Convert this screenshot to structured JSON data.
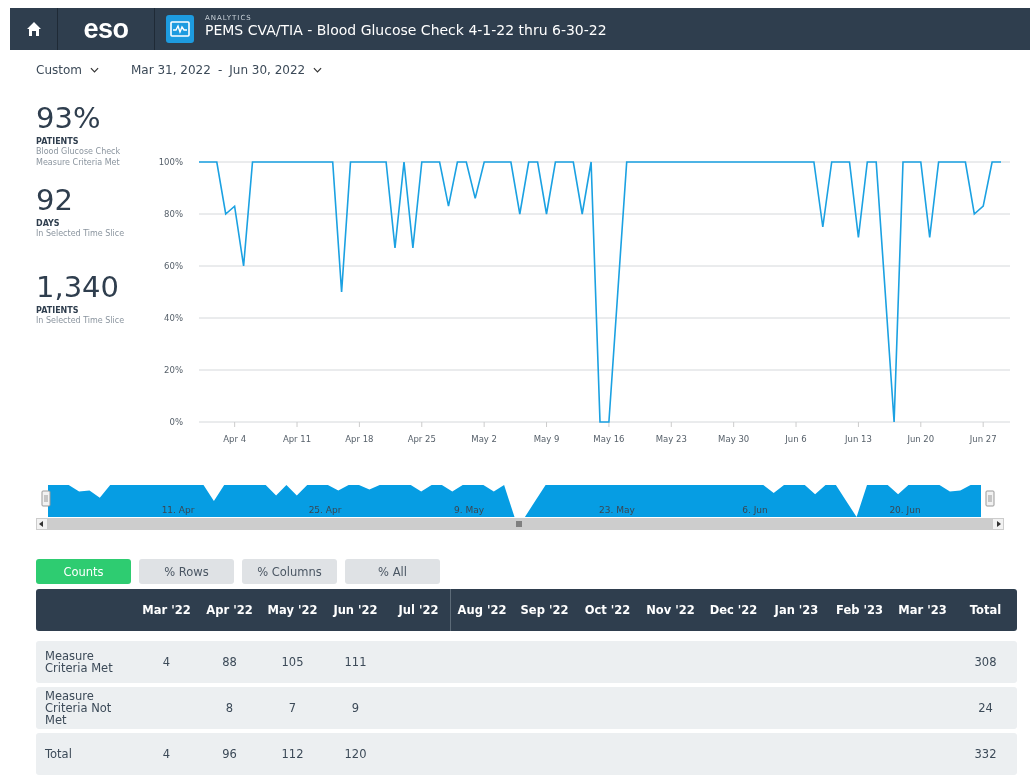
{
  "header": {
    "logo": "eso",
    "section": "ANALYTICS",
    "title": "PEMS CVA/TIA - Blood Glucose Check 4-1-22 thru 6-30-22"
  },
  "filters": {
    "period": "Custom",
    "date_from": "Mar 31, 2022",
    "separator": "-",
    "date_to": "Jun 30, 2022"
  },
  "stats": [
    {
      "value": "93%",
      "label": "PATIENTS",
      "caption": "Blood Glucose Check Measure Criteria Met"
    },
    {
      "value": "92",
      "label": "DAYS",
      "caption": "In Selected Time Slice"
    },
    {
      "value": "1,340",
      "label": "PATIENTS",
      "caption": "In Selected Time Slice"
    }
  ],
  "chart": {
    "chart_data": {
      "type": "line",
      "grid": true,
      "ylim": [
        0,
        100
      ],
      "categories": [
        null,
        null,
        null,
        null,
        "Apr 4",
        null,
        null,
        null,
        null,
        null,
        null,
        "Apr 11",
        null,
        null,
        null,
        null,
        null,
        null,
        "Apr 18",
        null,
        null,
        null,
        null,
        null,
        null,
        "Apr 25",
        null,
        null,
        null,
        null,
        null,
        null,
        "May 2",
        null,
        null,
        null,
        null,
        null,
        null,
        "May 9",
        null,
        null,
        null,
        null,
        null,
        null,
        "May 16",
        null,
        null,
        null,
        null,
        null,
        null,
        "May 23",
        null,
        null,
        null,
        null,
        null,
        null,
        "May 30",
        null,
        null,
        null,
        null,
        null,
        null,
        "Jun 6",
        null,
        null,
        null,
        null,
        null,
        null,
        "Jun 13",
        null,
        null,
        null,
        null,
        null,
        null,
        "Jun 20",
        null,
        null,
        null,
        null,
        null,
        null,
        "Jun 27",
        null,
        null
      ],
      "yticks": [
        {
          "value": 0,
          "label": "0%"
        },
        {
          "value": 20,
          "label": "20%"
        },
        {
          "value": 40,
          "label": "40%"
        },
        {
          "value": 60,
          "label": "60%"
        },
        {
          "value": 80,
          "label": "80%"
        },
        {
          "value": 100,
          "label": "100%"
        }
      ],
      "series": [
        {
          "color": "#1ba1e2",
          "values": [
            100,
            100,
            100,
            80,
            83,
            60,
            100,
            100,
            100,
            100,
            100,
            100,
            100,
            100,
            100,
            100,
            50,
            100,
            100,
            100,
            100,
            100,
            67,
            100,
            67,
            100,
            100,
            100,
            83,
            100,
            100,
            86,
            100,
            100,
            100,
            100,
            80,
            100,
            100,
            80,
            100,
            100,
            100,
            80,
            100,
            0,
            0,
            50,
            100,
            100,
            100,
            100,
            100,
            100,
            100,
            100,
            100,
            100,
            100,
            100,
            100,
            100,
            100,
            100,
            100,
            100,
            100,
            100,
            100,
            100,
            75,
            100,
            100,
            100,
            71,
            100,
            100,
            50,
            0,
            100,
            100,
            100,
            71,
            100,
            100,
            100,
            100,
            80,
            83,
            100,
            100
          ]
        }
      ]
    }
  },
  "navigator": {
    "labels": [
      "11. Apr",
      "25. Apr",
      "9. May",
      "23. May",
      "6. Jun",
      "20. Jun"
    ]
  },
  "view_buttons": [
    {
      "label": "Counts",
      "selected": true
    },
    {
      "label": "% Rows",
      "selected": false
    },
    {
      "label": "% Columns",
      "selected": false
    },
    {
      "label": "% All",
      "selected": false
    }
  ],
  "table": {
    "columns": [
      "Mar '22",
      "Apr '22",
      "May '22",
      "Jun '22",
      "Jul '22",
      "Aug '22",
      "Sep '22",
      "Oct '22",
      "Nov '22",
      "Dec '22",
      "Jan '23",
      "Feb '23",
      "Mar '23",
      "Total"
    ],
    "rows": [
      {
        "label": "Measure Criteria Met",
        "cells": [
          "4",
          "88",
          "105",
          "111",
          null,
          null,
          null,
          null,
          null,
          null,
          null,
          null,
          null,
          "308"
        ]
      },
      {
        "label": "Measure Criteria Not Met",
        "cells": [
          null,
          "8",
          "7",
          "9",
          null,
          null,
          null,
          null,
          null,
          null,
          null,
          null,
          null,
          "24"
        ]
      },
      {
        "label": "Total",
        "cells": [
          "4",
          "96",
          "112",
          "120",
          null,
          null,
          null,
          null,
          null,
          null,
          null,
          null,
          null,
          "332"
        ]
      }
    ]
  }
}
